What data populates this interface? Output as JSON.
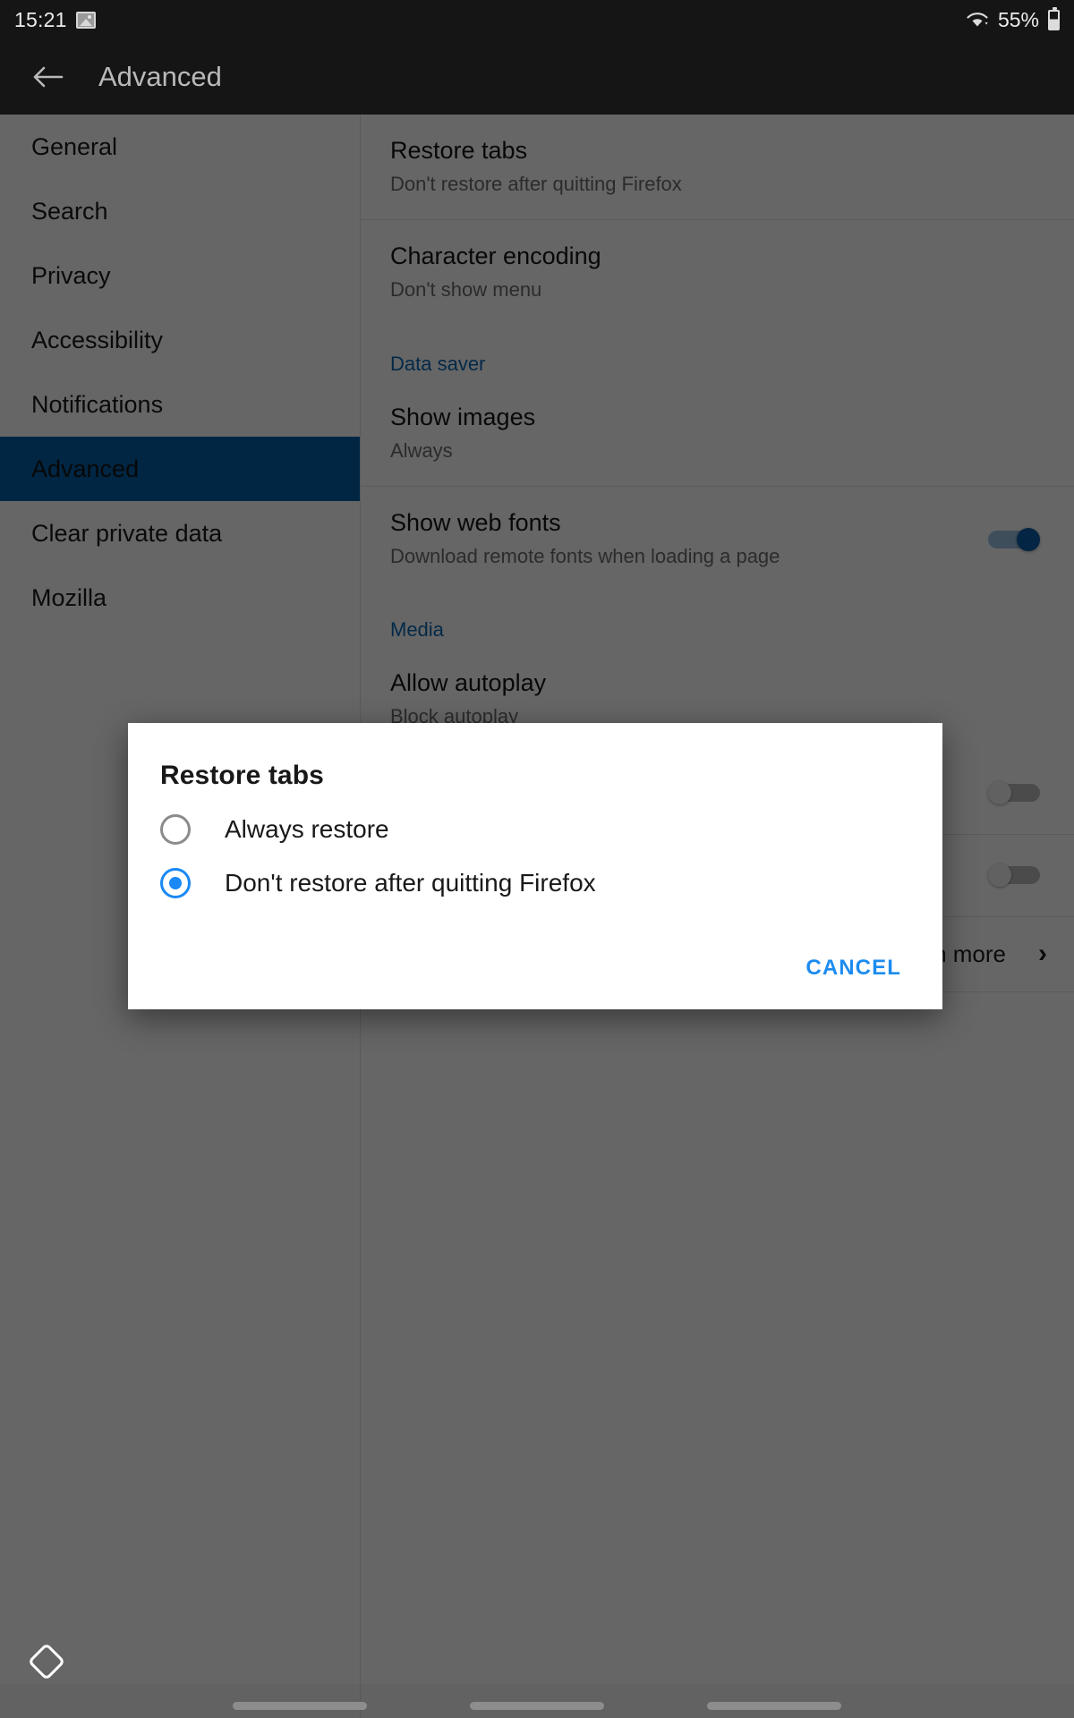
{
  "status_bar": {
    "time": "15:21",
    "battery_percent": "55%",
    "icons": [
      "photo-icon",
      "wifi-icon",
      "battery-icon"
    ]
  },
  "action_bar": {
    "back_icon": "back-arrow-icon",
    "title": "Advanced"
  },
  "sidebar": {
    "items": [
      {
        "label": "General",
        "selected": false
      },
      {
        "label": "Search",
        "selected": false
      },
      {
        "label": "Privacy",
        "selected": false
      },
      {
        "label": "Accessibility",
        "selected": false
      },
      {
        "label": "Notifications",
        "selected": false
      },
      {
        "label": "Advanced",
        "selected": true
      },
      {
        "label": "Clear private data",
        "selected": false
      },
      {
        "label": "Mozilla",
        "selected": false
      }
    ],
    "selected_index": 5,
    "selected_color": "#0060a8"
  },
  "content": {
    "rows": [
      {
        "title": "Restore tabs",
        "subtitle": "Don't restore after quitting Firefox"
      },
      {
        "title": "Character encoding",
        "subtitle": "Don't show menu"
      }
    ],
    "section_data_saver": "Data saver",
    "data_saver_rows": [
      {
        "title": "Show images",
        "subtitle": "Always"
      },
      {
        "title": "Show web fonts",
        "subtitle": "Download remote fonts when loading a page",
        "toggle": "on"
      }
    ],
    "section_media": "Media",
    "media_rows": [
      {
        "title": "Allow autoplay",
        "subtitle": "Block autoplay"
      },
      {
        "title": "",
        "subtitle": "",
        "toggle": "off"
      },
      {
        "title": "",
        "subtitle": "",
        "toggle": "off"
      }
    ],
    "learn_more": "Learn more",
    "section_color": "#0a66b5"
  },
  "dialog": {
    "title": "Restore tabs",
    "options": [
      {
        "label": "Always restore",
        "checked": false
      },
      {
        "label": "Don't restore after quitting Firefox",
        "checked": true
      }
    ],
    "cancel_label": "CANCEL",
    "accent_color": "#1a89f5"
  }
}
